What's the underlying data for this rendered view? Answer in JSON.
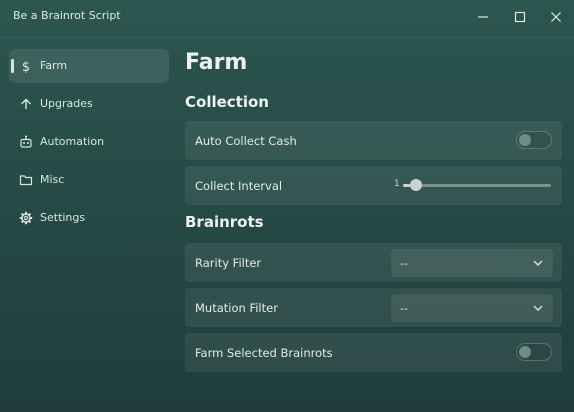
{
  "window": {
    "title": "Be a Brainrot Script"
  },
  "sidebar": {
    "items": [
      {
        "label": "Farm",
        "icon": "dollar-icon",
        "active": true
      },
      {
        "label": "Upgrades",
        "icon": "arrow-up-icon",
        "active": false
      },
      {
        "label": "Automation",
        "icon": "robot-icon",
        "active": false
      },
      {
        "label": "Misc",
        "icon": "folder-icon",
        "active": false
      },
      {
        "label": "Settings",
        "icon": "gear-icon",
        "active": false
      }
    ]
  },
  "main": {
    "title": "Farm",
    "sections": {
      "collection": {
        "title": "Collection",
        "auto_collect": {
          "label": "Auto Collect Cash",
          "enabled": false
        },
        "collect_interval": {
          "label": "Collect Interval",
          "value": "1",
          "level": 0.05
        }
      },
      "brainrots": {
        "title": "Brainrots",
        "rarity_filter": {
          "label": "Rarity Filter",
          "value": "--"
        },
        "mutation_filter": {
          "label": "Mutation Filter",
          "value": "--"
        },
        "farm_selected": {
          "label": "Farm Selected Brainrots",
          "enabled": false
        }
      }
    }
  }
}
